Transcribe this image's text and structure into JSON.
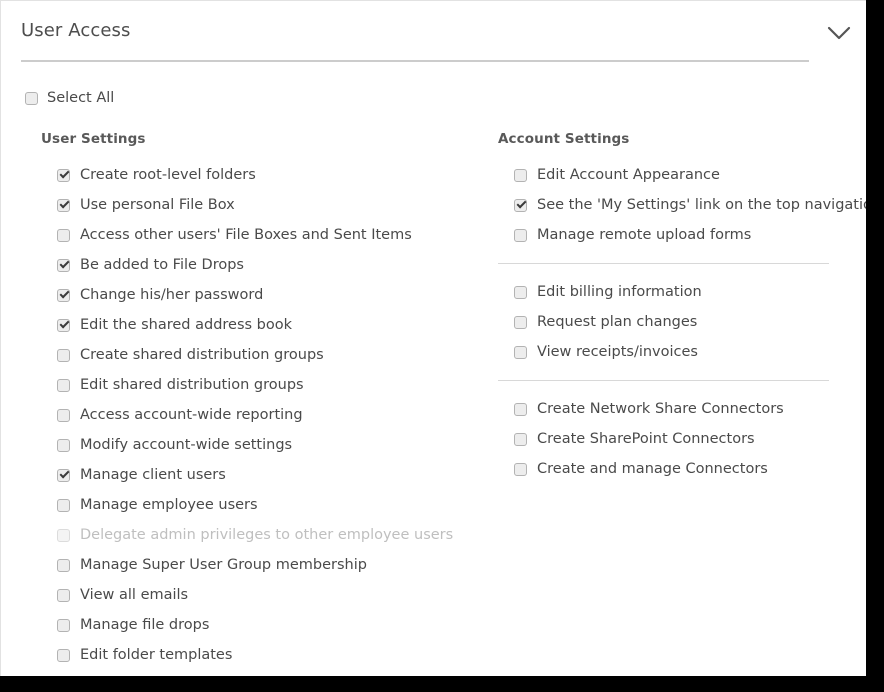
{
  "panel": {
    "title": "User Access",
    "collapse_icon": "chevron-down-icon",
    "select_all_label": "Select All",
    "select_all_checked": false
  },
  "colors": {
    "page_background": "#000000",
    "card_background": "#ffffff",
    "title_text": "#4d4d4d",
    "label_text": "#4a4a4a",
    "disabled_text": "#bfbfbf",
    "heading_text": "#595959",
    "divider": "#cccccc",
    "separator": "#d8d8d8",
    "checkbox_fill": "#ededed",
    "checkbox_border": "#b3b3b3",
    "checkmark": "#3b3b3b"
  },
  "columns": [
    {
      "heading": "User Settings",
      "groups": [
        {
          "items": [
            {
              "label": "Create root-level folders",
              "checked": true,
              "disabled": false
            },
            {
              "label": "Use personal File Box",
              "checked": true,
              "disabled": false
            },
            {
              "label": "Access other users' File Boxes and Sent Items",
              "checked": false,
              "disabled": false
            },
            {
              "label": "Be added to File Drops",
              "checked": true,
              "disabled": false
            },
            {
              "label": "Change his/her password",
              "checked": true,
              "disabled": false
            },
            {
              "label": "Edit the shared address book",
              "checked": true,
              "disabled": false
            },
            {
              "label": "Create shared distribution groups",
              "checked": false,
              "disabled": false
            },
            {
              "label": "Edit shared distribution groups",
              "checked": false,
              "disabled": false
            },
            {
              "label": "Access account-wide reporting",
              "checked": false,
              "disabled": false
            },
            {
              "label": "Modify account-wide settings",
              "checked": false,
              "disabled": false
            },
            {
              "label": "Manage client users",
              "checked": true,
              "disabled": false
            },
            {
              "label": "Manage employee users",
              "checked": false,
              "disabled": false
            },
            {
              "label": "Delegate admin privileges to other employee users",
              "checked": false,
              "disabled": true
            },
            {
              "label": "Manage Super User Group membership",
              "checked": false,
              "disabled": false
            },
            {
              "label": "View all emails",
              "checked": false,
              "disabled": false
            },
            {
              "label": "Manage file drops",
              "checked": false,
              "disabled": false
            },
            {
              "label": "Edit folder templates",
              "checked": false,
              "disabled": false
            }
          ]
        }
      ]
    },
    {
      "heading": "Account Settings",
      "groups": [
        {
          "items": [
            {
              "label": "Edit Account Appearance",
              "checked": false,
              "disabled": false
            },
            {
              "label": "See the 'My Settings' link on the top navigation bar",
              "checked": true,
              "disabled": false
            },
            {
              "label": "Manage remote upload forms",
              "checked": false,
              "disabled": false
            }
          ]
        },
        {
          "items": [
            {
              "label": "Edit billing information",
              "checked": false,
              "disabled": false
            },
            {
              "label": "Request plan changes",
              "checked": false,
              "disabled": false
            },
            {
              "label": "View receipts/invoices",
              "checked": false,
              "disabled": false
            }
          ]
        },
        {
          "items": [
            {
              "label": "Create Network Share Connectors",
              "checked": false,
              "disabled": false
            },
            {
              "label": "Create SharePoint Connectors",
              "checked": false,
              "disabled": false
            },
            {
              "label": "Create and manage Connectors",
              "checked": false,
              "disabled": false
            }
          ]
        }
      ]
    }
  ]
}
